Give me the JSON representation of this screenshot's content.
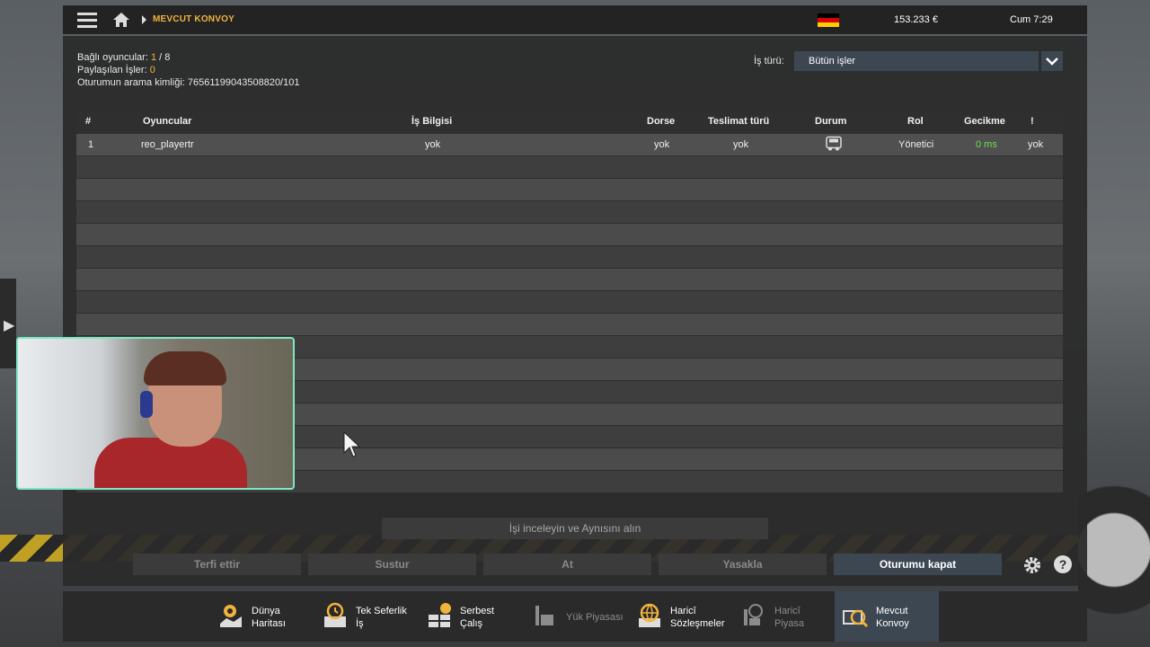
{
  "topbar": {
    "breadcrumb": "MEVCUT KONVOY",
    "money": "153.233 €",
    "time": "Cum 7:29"
  },
  "session": {
    "players_label": "Bağlı oyuncular: ",
    "players_current": "1",
    "players_max": " / 8",
    "shared_label": "Paylaşılan İşler: ",
    "shared_value": "0",
    "search_id_label": "Oturumun arama kimliği: ",
    "search_id_value": "76561199043508820/101"
  },
  "filter": {
    "label": "İş türü:",
    "selected": "Bütün işler"
  },
  "table": {
    "headers": {
      "num": "#",
      "players": "Oyuncular",
      "job_info": "İş Bilgisi",
      "trailer": "Dorse",
      "delivery": "Teslimat türü",
      "status": "Durum",
      "role": "Rol",
      "delay": "Gecikme",
      "warn": "!"
    },
    "rows": [
      {
        "num": "1",
        "player": "reo_playertr",
        "job_info": "yok",
        "trailer": "yok",
        "delivery": "yok",
        "status_icon": "truck-icon",
        "role": "Yönetici",
        "delay": "0 ms",
        "warn": "yok"
      }
    ]
  },
  "actions": {
    "inspect": "İşi inceleyin ve Aynısını alın",
    "promote": "Terfi ettir",
    "mute": "Sustur",
    "kick": "At",
    "ban": "Yasakla",
    "close_session": "Oturumu kapat"
  },
  "nav": {
    "world_map": "Dünya\nHaritası",
    "single_job": "Tek Seferlik\nİş",
    "free_work": "Serbest\nÇalış",
    "cargo_market": "Yük Piyasası",
    "ext_contracts": "Haricî\nSözleşmeler",
    "ext_market": "Haricî\nPiyasa",
    "current_convoy": "Mevcut\nKonvoy"
  },
  "colors": {
    "accent": "#f2b33d",
    "active": "#3d4752",
    "ping": "#6ee04a"
  }
}
